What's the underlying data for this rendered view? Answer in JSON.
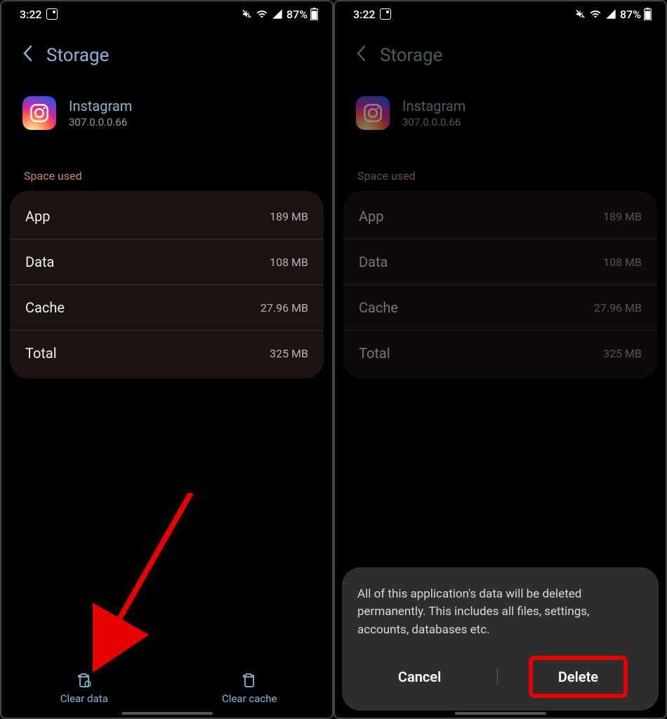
{
  "statusBar": {
    "time": "3:22",
    "battery": "87%"
  },
  "header": {
    "title": "Storage"
  },
  "app": {
    "name": "Instagram",
    "version": "307.0.0.0.66"
  },
  "sectionLabel": "Space used",
  "storage": [
    {
      "label": "App",
      "value": "189 MB"
    },
    {
      "label": "Data",
      "value": "108 MB"
    },
    {
      "label": "Cache",
      "value": "27.96 MB"
    },
    {
      "label": "Total",
      "value": "325 MB"
    }
  ],
  "actions": {
    "clearData": "Clear data",
    "clearCache": "Clear cache"
  },
  "dialog": {
    "message": "All of this application's data will be deleted permanently. This includes all files, settings, accounts, databases etc.",
    "cancel": "Cancel",
    "confirm": "Delete"
  }
}
